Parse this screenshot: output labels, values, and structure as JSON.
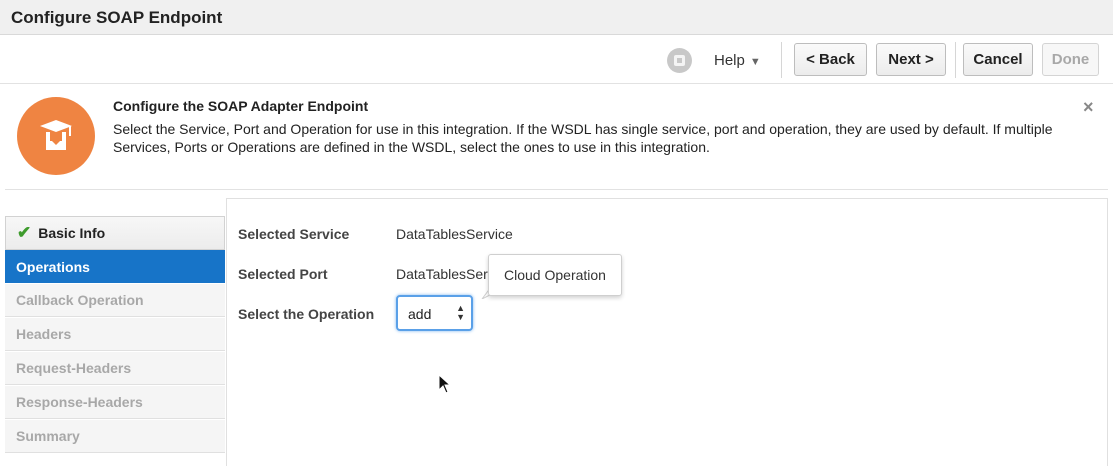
{
  "window": {
    "title": "Configure SOAP Endpoint"
  },
  "toolbar": {
    "user_icon": "user-avatar-icon",
    "help_label": "Help",
    "back_label": "< Back",
    "next_label": "Next >",
    "cancel_label": "Cancel",
    "done_label": "Done"
  },
  "banner": {
    "icon": "graduation-cap-icon",
    "title": "Configure the SOAP Adapter Endpoint",
    "description": "Select the Service, Port and Operation for use in this integration. If the WSDL has single service, port and operation, they are used by default. If multiple Services, Ports or Operations are defined in the WSDL, select the ones to use in this integration.",
    "close_label": "×"
  },
  "nav": {
    "items": [
      {
        "label": "Basic Info",
        "state": "done"
      },
      {
        "label": "Operations",
        "state": "active"
      },
      {
        "label": "Callback Operation",
        "state": "disabled"
      },
      {
        "label": "Headers",
        "state": "disabled"
      },
      {
        "label": "Request-Headers",
        "state": "disabled"
      },
      {
        "label": "Response-Headers",
        "state": "disabled"
      },
      {
        "label": "Summary",
        "state": "disabled"
      }
    ]
  },
  "form": {
    "service_label": "Selected Service",
    "service_value": "DataTablesService",
    "port_label": "Selected Port",
    "port_value": "DataTablesSer",
    "operation_label": "Select the Operation",
    "operation_value": "add"
  },
  "tooltip": {
    "text": "Cloud Operation"
  },
  "colors": {
    "accent": "#1774c8",
    "brand_orange": "#ef8442",
    "check_green": "#3e9b2d"
  }
}
